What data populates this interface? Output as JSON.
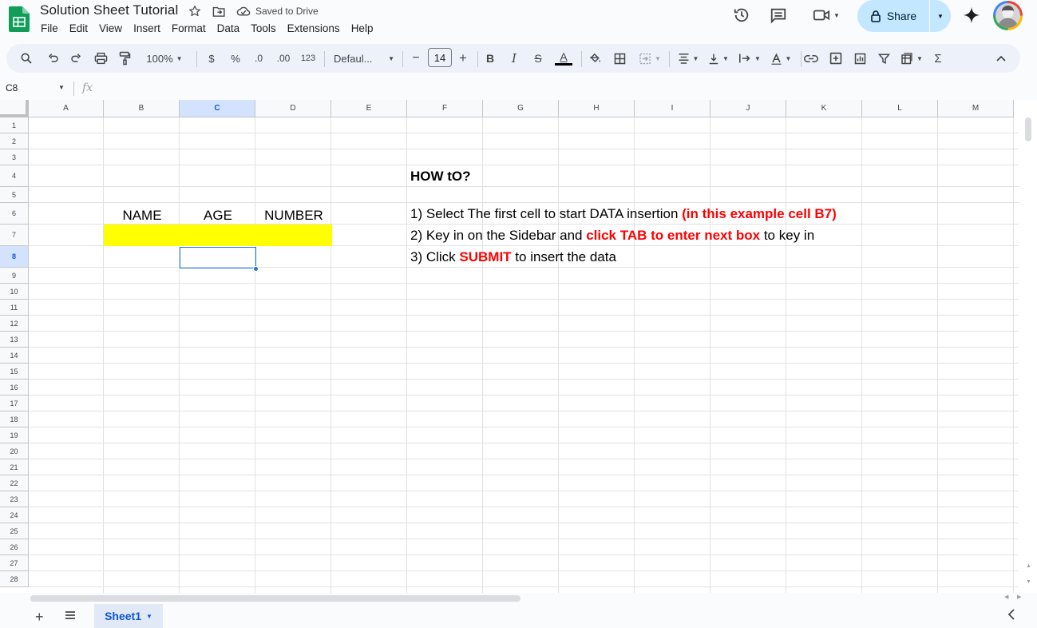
{
  "header": {
    "doc_title": "Solution Sheet Tutorial",
    "saved_status": "Saved to Drive",
    "share_label": "Share",
    "menu": [
      "File",
      "Edit",
      "View",
      "Insert",
      "Format",
      "Data",
      "Tools",
      "Extensions",
      "Help"
    ]
  },
  "toolbar": {
    "zoom": "100%",
    "currency": "$",
    "percent": "%",
    "decrease_decimal": ".0",
    "increase_decimal": ".00",
    "number_format": "123",
    "font": "Defaul...",
    "font_size": "14",
    "minus": "−",
    "plus": "+",
    "bold": "B",
    "italic": "I",
    "strike": "S",
    "text_color": "A",
    "text_color_swatch": "#000000",
    "function": "Σ"
  },
  "formula_bar": {
    "name_box": "C8",
    "fx": "fx"
  },
  "grid": {
    "columns": [
      "A",
      "B",
      "C",
      "D",
      "E",
      "F",
      "G",
      "H",
      "I",
      "J",
      "K",
      "L",
      "M"
    ],
    "selected_column": "C",
    "rows": [
      "1",
      "2",
      "3",
      "4",
      "5",
      "6",
      "7",
      "8",
      "9",
      "10",
      "11",
      "12",
      "13",
      "14",
      "15",
      "16",
      "17",
      "18",
      "19",
      "20",
      "21",
      "22",
      "23",
      "24",
      "25",
      "26",
      "27",
      "28"
    ],
    "selected_row": "8",
    "highlight_color": "#ffff00",
    "selection_color": "#1a73e8"
  },
  "cells": {
    "b6": "NAME",
    "c6": "AGE",
    "d6": "NUMBER",
    "f4": "HOW tO?",
    "f6_a": "1) Select The first cell to start DATA insertion ",
    "f6_b": "(in this example cell B7)",
    "f7_a": "2) Key in on the Sidebar and ",
    "f7_b": "click TAB to enter next box",
    "f7_c": " to key in",
    "f8_a": "3) Click ",
    "f8_b": "SUBMIT",
    "f8_c": " to insert the data"
  },
  "sheetbar": {
    "add": "+",
    "tab_name": "Sheet1"
  }
}
